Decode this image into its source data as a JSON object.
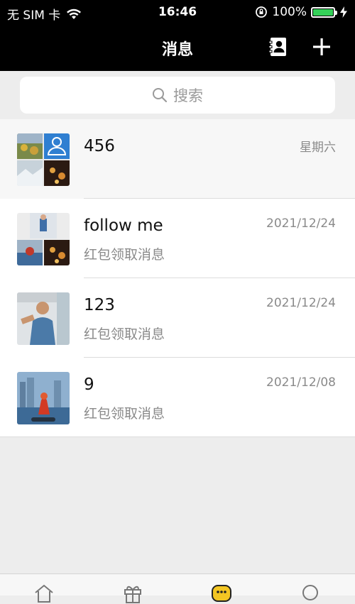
{
  "status_bar": {
    "carrier": "无 SIM 卡",
    "time": "16:46",
    "battery": "100%",
    "battery_level": 1.0
  },
  "nav": {
    "title": "消息"
  },
  "search": {
    "placeholder": "搜索"
  },
  "conversations": [
    {
      "name": "456",
      "subtitle": "",
      "time": "星期六"
    },
    {
      "name": "follow me",
      "subtitle": "红包领取消息",
      "time": "2021/12/24"
    },
    {
      "name": "123",
      "subtitle": "红包领取消息",
      "time": "2021/12/24"
    },
    {
      "name": "9",
      "subtitle": "红包领取消息",
      "time": "2021/12/08"
    }
  ],
  "tab_bar": {
    "icons": [
      "home-icon",
      "gift-icon",
      "chat-icon",
      "search-icon"
    ],
    "active_color": "#f3c623"
  },
  "colors": {
    "header_bg": "#000000",
    "battery_green": "#34d158"
  }
}
